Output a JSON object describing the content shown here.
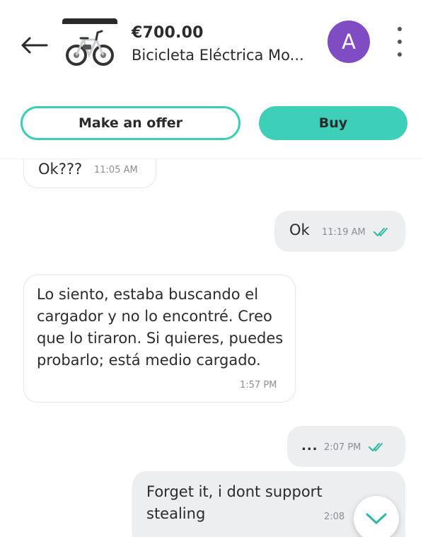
{
  "header": {
    "price": "€700.00",
    "title": "Bicicleta Eléctrica Mo...",
    "avatar_letter": "A"
  },
  "actions": {
    "offer_label": "Make an offer",
    "buy_label": "Buy"
  },
  "messages": [
    {
      "direction": "in",
      "text": "Ok???",
      "time": "11:05 AM"
    },
    {
      "direction": "out",
      "text": "Ok",
      "time": "11:19 AM",
      "status": "read"
    },
    {
      "direction": "in",
      "text": "Lo siento, estaba buscando el cargador y no lo encontré. Creo que lo tiraron. Si quieres, puedes probarlo; está medio cargado.",
      "time": "1:57 PM"
    },
    {
      "direction": "out",
      "text": "...",
      "time": "2:07 PM",
      "status": "read"
    },
    {
      "direction": "out",
      "text": "Forget it, i dont support stealing",
      "time": "2:08 PM"
    }
  ],
  "colors": {
    "accent": "#3ecfb9",
    "avatar": "#7f4cc4",
    "outgoing_bubble": "#eceef0",
    "read_ticks": "#2fb8a5"
  },
  "icons": {
    "back": "arrow-left-icon",
    "menu": "more-vertical-icon",
    "read": "double-check-icon",
    "scroll": "chevron-down-icon"
  }
}
